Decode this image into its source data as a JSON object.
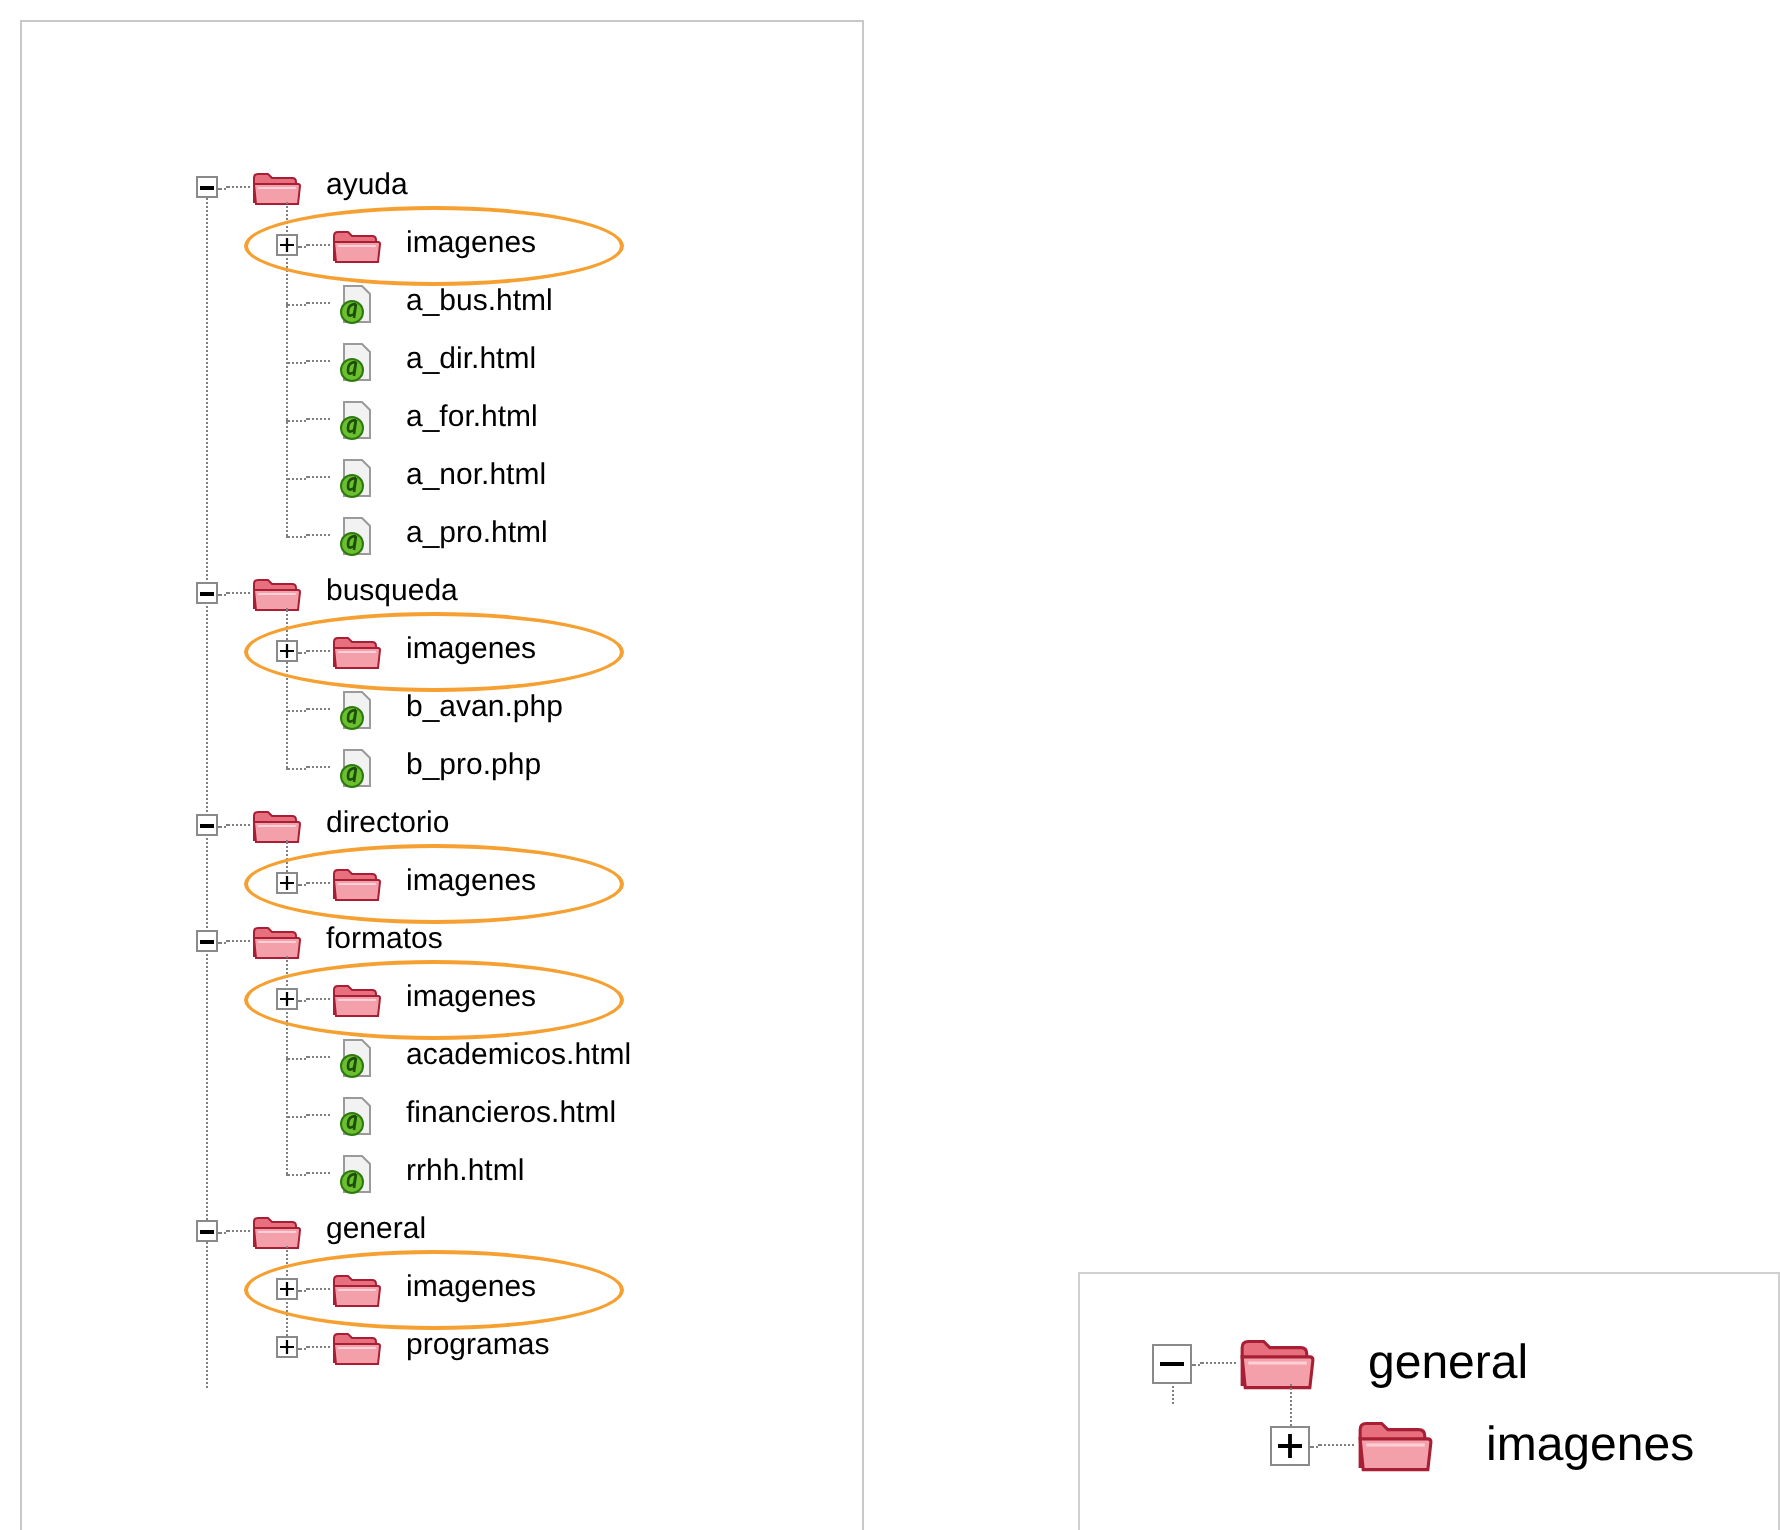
{
  "tree": [
    {
      "kind": "folder",
      "label": "ayuda",
      "expanded": true,
      "highlighted": false,
      "children": [
        {
          "kind": "folder",
          "label": "imagenes",
          "expanded": false,
          "highlighted": true
        },
        {
          "kind": "file",
          "label": "a_bus.html",
          "highlighted": false
        },
        {
          "kind": "file",
          "label": "a_dir.html",
          "highlighted": false
        },
        {
          "kind": "file",
          "label": "a_for.html",
          "highlighted": false
        },
        {
          "kind": "file",
          "label": "a_nor.html",
          "highlighted": false
        },
        {
          "kind": "file",
          "label": "a_pro.html",
          "highlighted": false
        }
      ]
    },
    {
      "kind": "folder",
      "label": "busqueda",
      "expanded": true,
      "highlighted": false,
      "children": [
        {
          "kind": "folder",
          "label": "imagenes",
          "expanded": false,
          "highlighted": true
        },
        {
          "kind": "file",
          "label": "b_avan.php",
          "highlighted": false
        },
        {
          "kind": "file",
          "label": "b_pro.php",
          "highlighted": false
        }
      ]
    },
    {
      "kind": "folder",
      "label": "directorio",
      "expanded": true,
      "highlighted": false,
      "children": [
        {
          "kind": "folder",
          "label": "imagenes",
          "expanded": false,
          "highlighted": true
        }
      ]
    },
    {
      "kind": "folder",
      "label": "formatos",
      "expanded": true,
      "highlighted": false,
      "children": [
        {
          "kind": "folder",
          "label": "imagenes",
          "expanded": false,
          "highlighted": true
        },
        {
          "kind": "file",
          "label": "academicos.html",
          "highlighted": false
        },
        {
          "kind": "file",
          "label": "financieros.html",
          "highlighted": false
        },
        {
          "kind": "file",
          "label": "rrhh.html",
          "highlighted": false
        }
      ]
    },
    {
      "kind": "folder",
      "label": "general",
      "expanded": true,
      "highlighted": false,
      "children": [
        {
          "kind": "folder",
          "label": "imagenes",
          "expanded": false,
          "highlighted": true
        },
        {
          "kind": "folder",
          "label": "programas",
          "expanded": false,
          "highlighted": false
        }
      ]
    }
  ],
  "zoom_inset": {
    "tree": [
      {
        "kind": "folder",
        "label": "general",
        "expanded": true,
        "children": [
          {
            "kind": "folder",
            "label": "imagenes",
            "expanded": false
          }
        ]
      }
    ]
  }
}
